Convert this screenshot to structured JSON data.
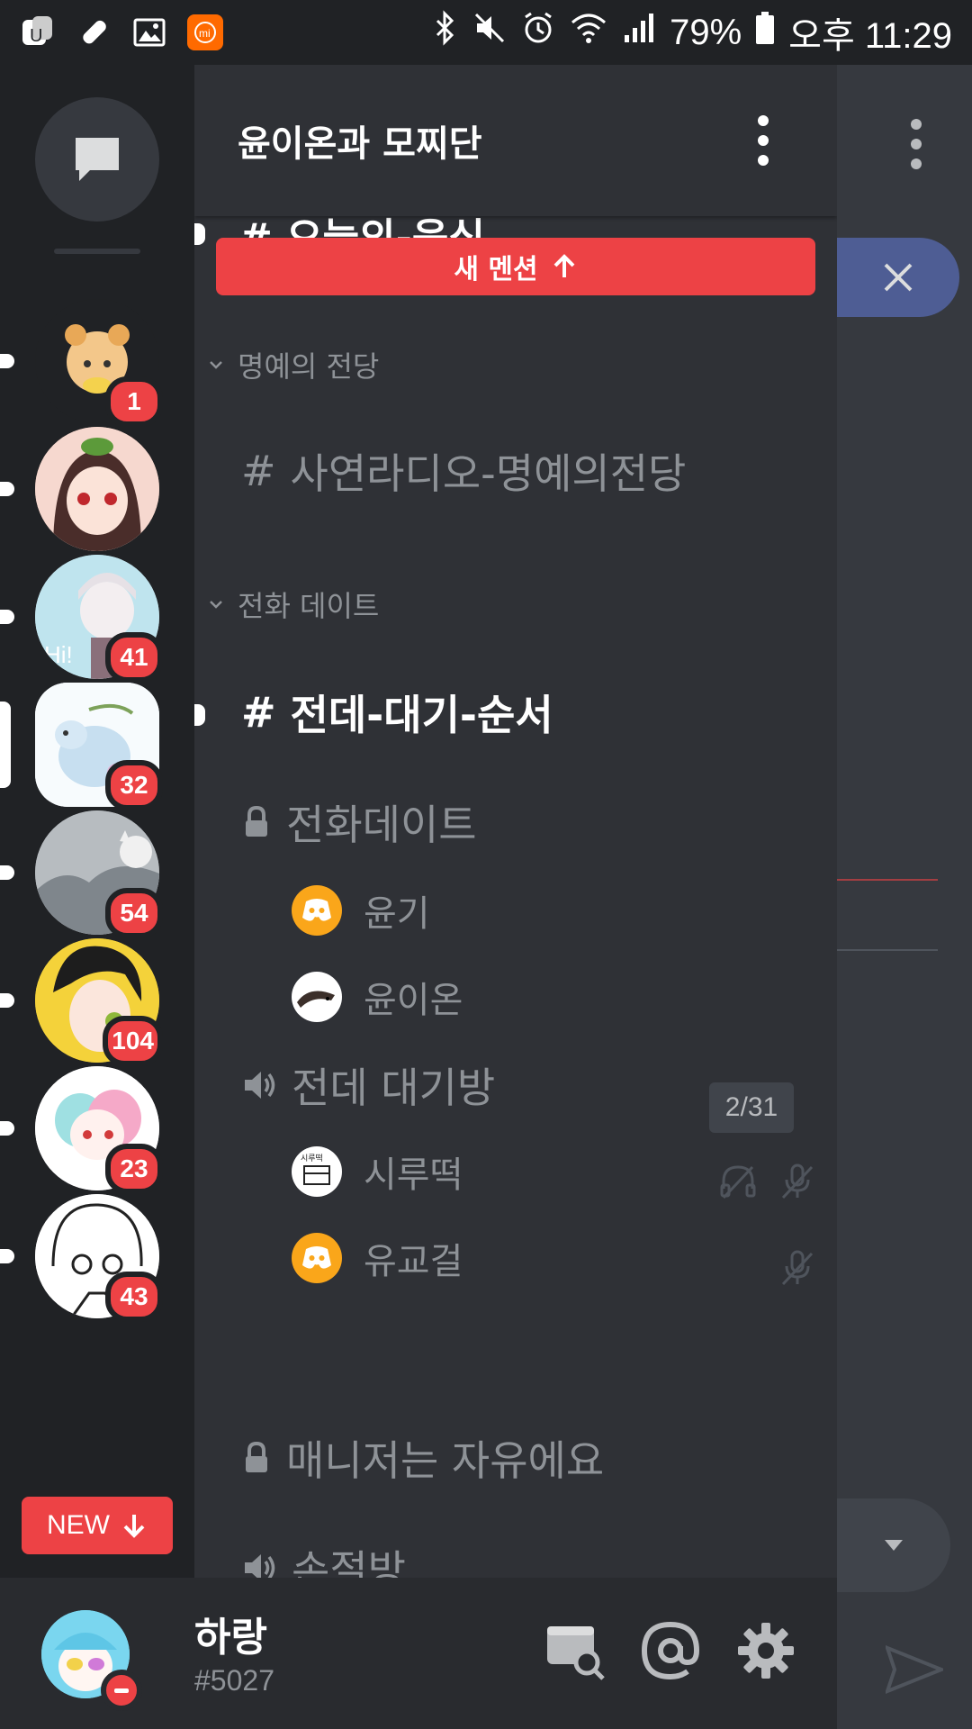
{
  "status_bar": {
    "battery": "79%",
    "time": "오후 11:29",
    "left_icons": [
      "app-icon",
      "pill-icon",
      "image-icon",
      "mi-icon"
    ],
    "right_icons": [
      "bluetooth-icon",
      "mute-icon",
      "alarm-icon",
      "wifi-icon",
      "signal-icon",
      "battery-icon"
    ]
  },
  "server_rail": {
    "servers": [
      {
        "name": "server-1",
        "badge": "1",
        "color": "#f0c089"
      },
      {
        "name": "server-2",
        "badge": "",
        "color": "#f2c0b0"
      },
      {
        "name": "server-3",
        "badge": "41",
        "color": "#cfe8ee"
      },
      {
        "name": "server-4",
        "badge": "32",
        "color": "#c7dff0",
        "selected": true
      },
      {
        "name": "server-5",
        "badge": "54",
        "color": "#a9aeb3"
      },
      {
        "name": "server-6",
        "badge": "104",
        "color": "#f4d23a"
      },
      {
        "name": "server-7",
        "badge": "23",
        "color": "#f6d6e2"
      },
      {
        "name": "server-8",
        "badge": "43",
        "color": "#f2f2f2"
      }
    ],
    "new_label": "NEW"
  },
  "channel_list": {
    "server_name": "윤이온과 모찌단",
    "cut_channel": "# 오늘의-음식",
    "mention_bar": "새 멘션",
    "categories": [
      {
        "name": "명예의 전당"
      },
      {
        "name": "전화 데이트"
      }
    ],
    "channels": {
      "hall": "사연라디오-명예의전당",
      "queue": "전데-대기-순서",
      "call_date": "전화데이트",
      "waiting_room": "전데 대기방",
      "manager": "매니저는 자유에요",
      "cut_room": "손절방"
    },
    "members_call_date": [
      "윤기",
      "윤이온"
    ],
    "members_waiting": [
      "시루떡",
      "유교걸"
    ],
    "waiting_count": "2/31"
  },
  "user_panel": {
    "username": "하랑",
    "tag": "#5027"
  },
  "colors": {
    "accent_red": "#ed4245",
    "bg_dark": "#202225",
    "bg_channels": "#2f3136"
  }
}
